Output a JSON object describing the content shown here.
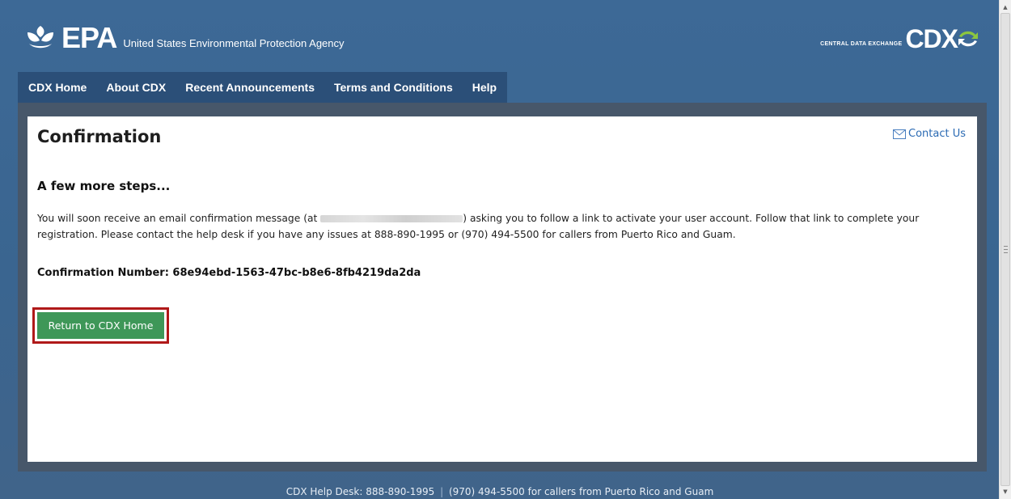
{
  "header": {
    "epa_logo_text": "EPA",
    "agency_name": "United States Environmental Protection Agency",
    "cdx_tagline": "CENTRAL DATA EXCHANGE",
    "cdx_logo_text": "CDX"
  },
  "nav": {
    "items": [
      {
        "label": "CDX Home"
      },
      {
        "label": "About CDX"
      },
      {
        "label": "Recent Announcements"
      },
      {
        "label": "Terms and Conditions"
      },
      {
        "label": "Help"
      }
    ]
  },
  "main": {
    "title": "Confirmation",
    "contact_label": "Contact Us",
    "section_heading": "A few more steps...",
    "message_part1": "You will soon receive an email confirmation message (at ",
    "message_part2": ") asking you to follow a link to activate your user account. Follow that link to complete your registration. Please contact the help desk if you have any issues at 888-890-1995 or (970) 494-5500 for callers from Puerto Rico and Guam.",
    "confirmation_label": "Confirmation Number:",
    "confirmation_number": "68e94ebd-1563-47bc-b8e6-8fb4219da2da",
    "return_button_label": "Return to CDX Home"
  },
  "footer": {
    "helpdesk_part1": "CDX Help Desk: 888-890-1995",
    "separator": "|",
    "helpdesk_part2": "(970) 494-5500 for callers from Puerto Rico and Guam"
  },
  "icons": {
    "epa_logo": "epa-flower-icon",
    "cdx_logo": "cdx-arrows-icon",
    "contact": "mail-icon"
  },
  "colors": {
    "header_bg": "#3a6590",
    "nav_bg": "#2b4f78",
    "frame_bg": "#47576a",
    "button_bg": "#3e9758",
    "highlight_border": "#b01919",
    "link": "#2a6ab3"
  }
}
